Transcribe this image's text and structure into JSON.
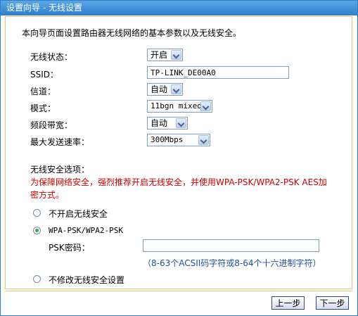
{
  "window": {
    "title": "设置向导 - 无线设置"
  },
  "intro": "本向导页面设置路由器无线网络的基本参数以及无线安全。",
  "fields": {
    "wireless_status": {
      "label": "无线状态：",
      "value": "开启"
    },
    "ssid": {
      "label": "SSID：",
      "value": "TP-LINK_DE00A0"
    },
    "channel": {
      "label": "信道：",
      "value": "自动"
    },
    "mode": {
      "label": "模式：",
      "value": "11bgn mixed"
    },
    "bandwidth": {
      "label": "频段带宽：",
      "value": "自动"
    },
    "max_rate": {
      "label": "最大发送速率：",
      "value": "300Mbps"
    }
  },
  "security": {
    "heading": "无线安全选项：",
    "warning": "为保障网络安全，强烈推荐开启无线安全，并使用WPA-PSK/WPA2-PSK AES加密方式。",
    "options": [
      {
        "label": "不开启无线安全",
        "checked": false
      },
      {
        "label": "WPA-PSK/WPA2-PSK",
        "checked": true
      },
      {
        "label": "不修改无线安全设置",
        "checked": false
      }
    ],
    "psk_label": "PSK密码：",
    "psk_value": "",
    "psk_hint": "（8-63个ACSII码字符或8-64个十六进制字符）"
  },
  "buttons": {
    "prev": "上一步",
    "next": "下一步"
  },
  "colors": {
    "titlebar": "#2f7fc8",
    "warning": "#cc0000",
    "panel_border": "#f0c078"
  }
}
